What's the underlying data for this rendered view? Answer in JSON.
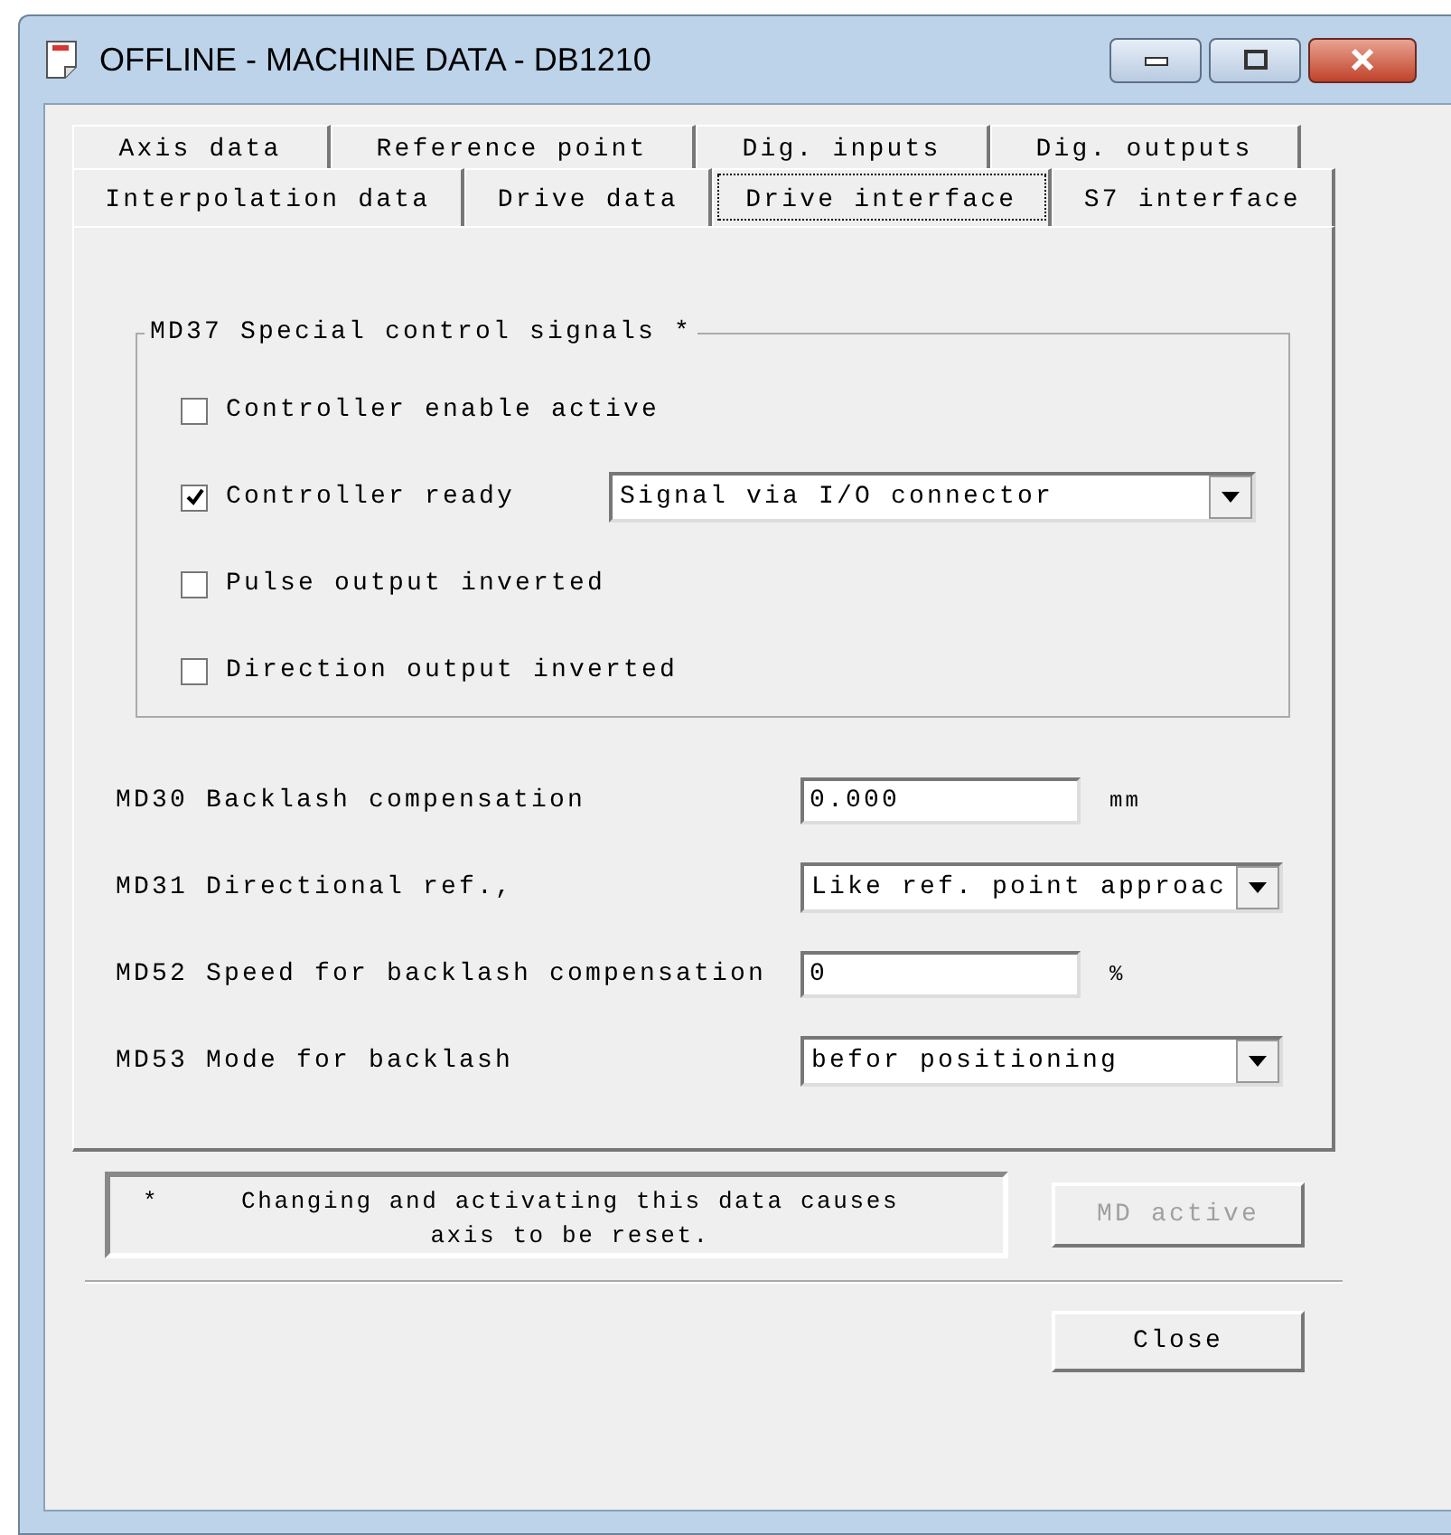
{
  "window": {
    "title": "OFFLINE - MACHINE DATA - DB1210"
  },
  "tab_rows": [
    [
      {
        "label": "Axis data",
        "selected": false
      },
      {
        "label": "Reference point",
        "selected": false
      },
      {
        "label": "Dig. inputs",
        "selected": false
      },
      {
        "label": "Dig. outputs",
        "selected": false
      }
    ],
    [
      {
        "label": "Interpolation data",
        "selected": false
      },
      {
        "label": "Drive data",
        "selected": false
      },
      {
        "label": "Drive interface",
        "selected": true
      },
      {
        "label": "S7 interface",
        "selected": false
      }
    ]
  ],
  "group": {
    "title": "MD37 Special control signals *",
    "items": [
      {
        "kind": "checkbox",
        "label": "Controller enable active",
        "checked": false
      },
      {
        "kind": "checkbox_select",
        "label": "Controller ready",
        "checked": true,
        "value": "Signal via I/O connector"
      },
      {
        "kind": "checkbox",
        "label": "Pulse output inverted",
        "checked": false
      },
      {
        "kind": "checkbox",
        "label": "Direction output inverted",
        "checked": false
      }
    ]
  },
  "fields": [
    {
      "kind": "input",
      "label": "MD30 Backlash compensation",
      "value": "0.000",
      "unit": "mm"
    },
    {
      "kind": "select",
      "label": "MD31 Directional ref.,",
      "value": "Like ref. point approac"
    },
    {
      "kind": "input",
      "label": "MD52 Speed for backlash compensation",
      "value": "0",
      "unit": "%"
    },
    {
      "kind": "select",
      "label": "MD53 Mode for backlash",
      "value": "befor positioning"
    }
  ],
  "note": {
    "mark": "*",
    "text": "Changing and activating this data causes axis to be reset."
  },
  "buttons": [
    {
      "label": "MD active",
      "disabled": true
    },
    {
      "label": "Close",
      "disabled": false
    }
  ]
}
